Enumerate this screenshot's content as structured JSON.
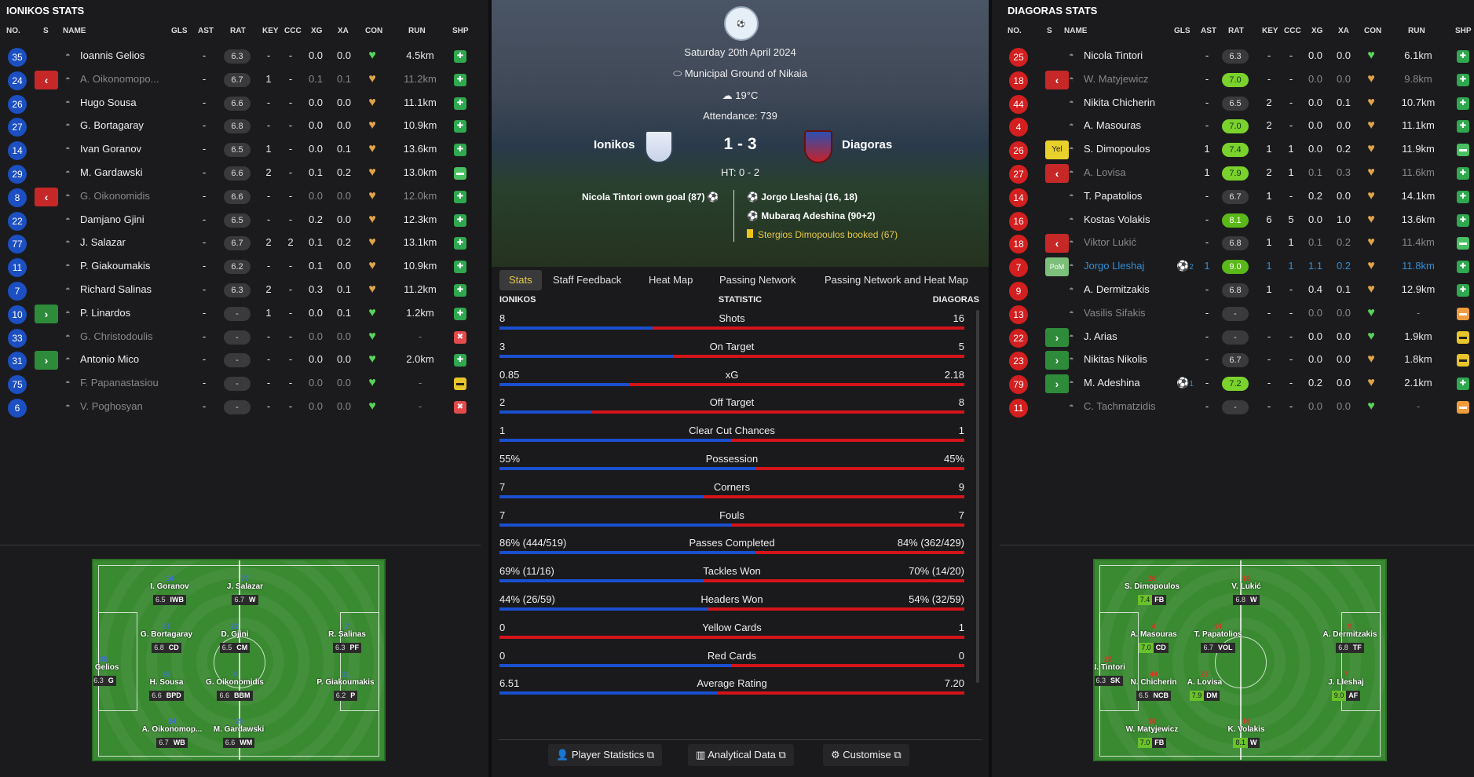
{
  "left": {
    "title": "IONIKOS STATS",
    "headers": [
      "NO.",
      "S",
      "NAME",
      "GLS",
      "AST",
      "RAT",
      "KEY",
      "CCC",
      "XG",
      "XA",
      "CON",
      "RUN",
      "SHP"
    ],
    "rows": [
      {
        "no": "35",
        "sub": "",
        "name": "Ioannis Gelios",
        "dim": false,
        "gls": "",
        "ast": "-",
        "rat": "6.3",
        "key": "-",
        "ccc": "-",
        "xg": "0.0",
        "xa": "0.0",
        "run": "4.5km",
        "shp": "g"
      },
      {
        "no": "24",
        "sub": "off",
        "name": "A. Oikonomopo...",
        "dim": true,
        "gls": "",
        "ast": "-",
        "rat": "6.7",
        "key": "1",
        "ccc": "-",
        "xg": "0.1",
        "xa": "0.1",
        "run": "11.2km",
        "shp": "g"
      },
      {
        "no": "26",
        "sub": "",
        "name": "Hugo Sousa",
        "dim": false,
        "gls": "",
        "ast": "-",
        "rat": "6.6",
        "key": "-",
        "ccc": "-",
        "xg": "0.0",
        "xa": "0.0",
        "run": "11.1km",
        "shp": "g"
      },
      {
        "no": "27",
        "sub": "",
        "name": "G. Bortagaray",
        "dim": false,
        "gls": "",
        "ast": "-",
        "rat": "6.8",
        "key": "-",
        "ccc": "-",
        "xg": "0.0",
        "xa": "0.0",
        "run": "10.9km",
        "shp": "g"
      },
      {
        "no": "14",
        "sub": "",
        "name": "Ivan Goranov",
        "dim": false,
        "gls": "",
        "ast": "-",
        "rat": "6.5",
        "key": "1",
        "ccc": "-",
        "xg": "0.0",
        "xa": "0.1",
        "run": "13.6km",
        "shp": "g"
      },
      {
        "no": "29",
        "sub": "",
        "name": "M. Gardawski",
        "dim": false,
        "gls": "",
        "ast": "-",
        "rat": "6.6",
        "key": "2",
        "ccc": "-",
        "xg": "0.1",
        "xa": "0.2",
        "run": "13.0km",
        "shp": "lg"
      },
      {
        "no": "8",
        "sub": "off",
        "name": "G. Oikonomidis",
        "dim": true,
        "gls": "",
        "ast": "-",
        "rat": "6.6",
        "key": "-",
        "ccc": "-",
        "xg": "0.0",
        "xa": "0.0",
        "run": "12.0km",
        "shp": "g"
      },
      {
        "no": "22",
        "sub": "",
        "name": "Damjano Gjini",
        "dim": false,
        "gls": "",
        "ast": "-",
        "rat": "6.5",
        "key": "-",
        "ccc": "-",
        "xg": "0.2",
        "xa": "0.0",
        "run": "12.3km",
        "shp": "g"
      },
      {
        "no": "77",
        "sub": "",
        "name": "J. Salazar",
        "dim": false,
        "gls": "",
        "ast": "-",
        "rat": "6.7",
        "key": "2",
        "ccc": "2",
        "xg": "0.1",
        "xa": "0.2",
        "run": "13.1km",
        "shp": "g"
      },
      {
        "no": "11",
        "sub": "",
        "name": "P. Giakoumakis",
        "dim": false,
        "gls": "",
        "ast": "-",
        "rat": "6.2",
        "key": "-",
        "ccc": "-",
        "xg": "0.1",
        "xa": "0.0",
        "run": "10.9km",
        "shp": "g"
      },
      {
        "no": "7",
        "sub": "",
        "name": "Richard Salinas",
        "dim": false,
        "gls": "",
        "ast": "-",
        "rat": "6.3",
        "key": "2",
        "ccc": "-",
        "xg": "0.3",
        "xa": "0.1",
        "run": "11.2km",
        "shp": "g"
      },
      {
        "no": "10",
        "sub": "on",
        "name": "P. Linardos",
        "dim": false,
        "gls": "",
        "ast": "-",
        "rat": "-",
        "key": "1",
        "ccc": "-",
        "xg": "0.0",
        "xa": "0.1",
        "run": "1.2km",
        "shp": "g"
      },
      {
        "no": "33",
        "sub": "",
        "name": "G. Christodoulis",
        "dim": true,
        "gls": "",
        "ast": "-",
        "rat": "-",
        "key": "-",
        "ccc": "-",
        "xg": "0.0",
        "xa": "0.0",
        "run": "-",
        "shp": "r"
      },
      {
        "no": "31",
        "sub": "on",
        "name": "Antonio Mico",
        "dim": false,
        "gls": "",
        "ast": "-",
        "rat": "-",
        "key": "-",
        "ccc": "-",
        "xg": "0.0",
        "xa": "0.0",
        "run": "2.0km",
        "shp": "g"
      },
      {
        "no": "75",
        "sub": "",
        "name": "F. Papanastasiou",
        "dim": true,
        "gls": "",
        "ast": "-",
        "rat": "-",
        "key": "-",
        "ccc": "-",
        "xg": "0.0",
        "xa": "0.0",
        "run": "-",
        "shp": "y"
      },
      {
        "no": "6",
        "sub": "",
        "name": "V. Poghosyan",
        "dim": true,
        "gls": "",
        "ast": "-",
        "rat": "-",
        "key": "-",
        "ccc": "-",
        "xg": "0.0",
        "xa": "0.0",
        "run": "-",
        "shp": "r"
      }
    ],
    "pitch": [
      {
        "no": "14",
        "name": "I. Goranov",
        "rat": "6.5",
        "pos": "IWB"
      },
      {
        "no": "77",
        "name": "J. Salazar",
        "rat": "6.7",
        "pos": "W"
      },
      {
        "no": "27",
        "name": "G. Bortagaray",
        "rat": "6.8",
        "pos": "CD"
      },
      {
        "no": "22",
        "name": "D. Gjini",
        "rat": "6.5",
        "pos": "CM"
      },
      {
        "no": "7",
        "name": "R. Salinas",
        "rat": "6.3",
        "pos": "PF"
      },
      {
        "no": "35",
        "name": "I. Gelios",
        "rat": "6.3",
        "pos": "G"
      },
      {
        "no": "26",
        "name": "H. Sousa",
        "rat": "6.6",
        "pos": "BPD"
      },
      {
        "no": "8",
        "name": "G. Oikonomidis",
        "rat": "6.6",
        "pos": "BBM"
      },
      {
        "no": "11",
        "name": "P. Giakoumakis",
        "rat": "6.2",
        "pos": "P"
      },
      {
        "no": "24",
        "name": "A. Oikonomop...",
        "rat": "6.7",
        "pos": "WB"
      },
      {
        "no": "29",
        "name": "M. Gardawski",
        "rat": "6.6",
        "pos": "WM"
      }
    ]
  },
  "right": {
    "title": "DIAGORAS STATS",
    "headers": [
      "NO.",
      "S",
      "NAME",
      "GLS",
      "AST",
      "RAT",
      "KEY",
      "CCC",
      "XG",
      "XA",
      "CON",
      "RUN",
      "SHP"
    ],
    "rows": [
      {
        "no": "25",
        "sub": "",
        "name": "Nicola Tintori",
        "dim": false,
        "gls": "",
        "ast": "-",
        "rat": "6.3",
        "rc": "",
        "key": "-",
        "ccc": "-",
        "xg": "0.0",
        "xa": "0.0",
        "run": "6.1km",
        "shp": "g"
      },
      {
        "no": "18",
        "sub": "off",
        "name": "W. Matyjewicz",
        "dim": true,
        "gls": "",
        "ast": "-",
        "rat": "7.0",
        "rc": "g1",
        "key": "-",
        "ccc": "-",
        "xg": "0.0",
        "xa": "0.0",
        "run": "9.8km",
        "shp": "g"
      },
      {
        "no": "44",
        "sub": "",
        "name": "Nikita Chicherin",
        "dim": false,
        "gls": "",
        "ast": "-",
        "rat": "6.5",
        "rc": "",
        "key": "2",
        "ccc": "-",
        "xg": "0.0",
        "xa": "0.1",
        "run": "10.7km",
        "shp": "g"
      },
      {
        "no": "4",
        "sub": "",
        "name": "A. Masouras",
        "dim": false,
        "gls": "",
        "ast": "-",
        "rat": "7.0",
        "rc": "g1",
        "key": "2",
        "ccc": "-",
        "xg": "0.0",
        "xa": "0.0",
        "run": "11.1km",
        "shp": "g"
      },
      {
        "no": "26",
        "sub": "yel",
        "name": "S. Dimopoulos",
        "dim": false,
        "gls": "",
        "ast": "1",
        "rat": "7.4",
        "rc": "g1",
        "key": "1",
        "ccc": "1",
        "xg": "0.0",
        "xa": "0.2",
        "run": "11.9km",
        "shp": "lg"
      },
      {
        "no": "27",
        "sub": "off",
        "name": "A. Lovisa",
        "dim": true,
        "gls": "",
        "ast": "1",
        "rat": "7.9",
        "rc": "g1",
        "key": "2",
        "ccc": "1",
        "xg": "0.1",
        "xa": "0.3",
        "run": "11.6km",
        "shp": "g"
      },
      {
        "no": "14",
        "sub": "",
        "name": "T. Papatolios",
        "dim": false,
        "gls": "",
        "ast": "-",
        "rat": "6.7",
        "rc": "",
        "key": "1",
        "ccc": "-",
        "xg": "0.2",
        "xa": "0.0",
        "run": "14.1km",
        "shp": "g"
      },
      {
        "no": "16",
        "sub": "",
        "name": "Kostas Volakis",
        "dim": false,
        "gls": "",
        "ast": "-",
        "rat": "8.1",
        "rc": "g2",
        "key": "6",
        "ccc": "5",
        "xg": "0.0",
        "xa": "1.0",
        "run": "13.6km",
        "shp": "g"
      },
      {
        "no": "18",
        "sub": "off",
        "name": "Viktor Lukić",
        "dim": true,
        "gls": "",
        "ast": "-",
        "rat": "6.8",
        "rc": "",
        "key": "1",
        "ccc": "1",
        "xg": "0.1",
        "xa": "0.2",
        "run": "11.4km",
        "shp": "lg"
      },
      {
        "no": "7",
        "sub": "pom",
        "name": "Jorgo Lleshaj",
        "dim": false,
        "pom": true,
        "gls": "2",
        "ast": "1",
        "rat": "9.0",
        "rc": "g2",
        "key": "1",
        "ccc": "1",
        "xg": "1.1",
        "xa": "0.2",
        "run": "11.8km",
        "shp": "g"
      },
      {
        "no": "9",
        "sub": "",
        "name": "A. Dermitzakis",
        "dim": false,
        "gls": "",
        "ast": "-",
        "rat": "6.8",
        "rc": "",
        "key": "1",
        "ccc": "-",
        "xg": "0.4",
        "xa": "0.1",
        "run": "12.9km",
        "shp": "g"
      },
      {
        "no": "13",
        "sub": "",
        "name": "Vasilis Sifakis",
        "dim": true,
        "gls": "",
        "ast": "-",
        "rat": "-",
        "rc": "",
        "key": "-",
        "ccc": "-",
        "xg": "0.0",
        "xa": "0.0",
        "run": "-",
        "shp": "o"
      },
      {
        "no": "22",
        "sub": "on",
        "name": "J. Arias",
        "dim": false,
        "gls": "",
        "ast": "-",
        "rat": "-",
        "rc": "",
        "key": "-",
        "ccc": "-",
        "xg": "0.0",
        "xa": "0.0",
        "run": "1.9km",
        "shp": "y"
      },
      {
        "no": "23",
        "sub": "on",
        "name": "Nikitas Nikolis",
        "dim": false,
        "gls": "",
        "ast": "-",
        "rat": "6.7",
        "rc": "",
        "key": "-",
        "ccc": "-",
        "xg": "0.0",
        "xa": "0.0",
        "run": "1.8km",
        "shp": "y"
      },
      {
        "no": "79",
        "sub": "on",
        "name": "M. Adeshina",
        "dim": false,
        "gls": "1",
        "ast": "-",
        "rat": "7.2",
        "rc": "g1",
        "key": "-",
        "ccc": "-",
        "xg": "0.2",
        "xa": "0.0",
        "run": "2.1km",
        "shp": "g"
      },
      {
        "no": "11",
        "sub": "",
        "name": "C. Tachmatzidis",
        "dim": true,
        "gls": "",
        "ast": "-",
        "rat": "-",
        "rc": "",
        "key": "-",
        "ccc": "-",
        "xg": "0.0",
        "xa": "0.0",
        "run": "-",
        "shp": "o"
      }
    ],
    "pitch": [
      {
        "no": "26",
        "name": "S. Dimopoulos",
        "rat": "7.4",
        "g": true,
        "pos": "FB"
      },
      {
        "no": "18",
        "name": "V. Lukić",
        "rat": "6.8",
        "g": false,
        "pos": "W"
      },
      {
        "no": "4",
        "name": "A. Masouras",
        "rat": "7.0",
        "g": true,
        "pos": "CD"
      },
      {
        "no": "14",
        "name": "T. Papatolios",
        "rat": "6.7",
        "g": false,
        "pos": "VOL"
      },
      {
        "no": "9",
        "name": "A. Dermitzakis",
        "rat": "6.8",
        "g": false,
        "pos": "TF"
      },
      {
        "no": "25",
        "name": "N. Tintori",
        "rat": "6.3",
        "g": false,
        "pos": "SK"
      },
      {
        "no": "44",
        "name": "N. Chicherin",
        "rat": "6.5",
        "g": false,
        "pos": "NCB"
      },
      {
        "no": "27",
        "name": "A. Lovisa",
        "rat": "7.9",
        "g": true,
        "pos": "DM"
      },
      {
        "no": "7",
        "name": "J. Lleshaj",
        "rat": "9.0",
        "g": true,
        "pos": "AF"
      },
      {
        "no": "18",
        "name": "W. Matyjewicz",
        "rat": "7.0",
        "g": true,
        "pos": "FB"
      },
      {
        "no": "16",
        "name": "K. Volakis",
        "rat": "8.1",
        "g": true,
        "pos": "W"
      }
    ]
  },
  "match": {
    "date": "Saturday 20th April 2024",
    "venue": "Municipal Ground of Nikaia",
    "weather": "19°C",
    "attendance": "Attendance: 739",
    "home": "Ionikos",
    "away": "Diagoras",
    "score": "1 - 3",
    "ht": "HT: 0 - 2",
    "home_events": [
      "Nicola Tintori own goal (87)"
    ],
    "away_events": [
      "Jorgo Lleshaj (16, 18)",
      "Mubaraq Adeshina (90+2)",
      "Stergios Dimopoulos booked (67)"
    ],
    "home_color": "#1a4fcf",
    "away_color": "#d3141a"
  },
  "tabs": [
    "Stats",
    "Staff Feedback",
    "Heat Map",
    "Passing Network",
    "Passing Network and Heat Map"
  ],
  "stats_header": {
    "home": "IONIKOS",
    "mid": "STATISTIC",
    "away": "DIAGORAS"
  },
  "stats": [
    {
      "label": "Shots",
      "home": "8",
      "away": "16",
      "share": 0.33
    },
    {
      "label": "On Target",
      "home": "3",
      "away": "5",
      "share": 0.375
    },
    {
      "label": "xG",
      "home": "0.85",
      "away": "2.18",
      "share": 0.28
    },
    {
      "label": "Off Target",
      "home": "2",
      "away": "8",
      "share": 0.2
    },
    {
      "label": "Clear Cut Chances",
      "home": "1",
      "away": "1",
      "share": 0.5
    },
    {
      "label": "Possession",
      "home": "55%",
      "away": "45%",
      "share": 0.55
    },
    {
      "label": "Corners",
      "home": "7",
      "away": "9",
      "share": 0.44
    },
    {
      "label": "Fouls",
      "home": "7",
      "away": "7",
      "share": 0.5
    },
    {
      "label": "Passes Completed",
      "home": "86% (444/519)",
      "away": "84% (362/429)",
      "share": 0.55
    },
    {
      "label": "Tackles Won",
      "home": "69% (11/16)",
      "away": "70% (14/20)",
      "share": 0.44
    },
    {
      "label": "Headers Won",
      "home": "44% (26/59)",
      "away": "54% (32/59)",
      "share": 0.45
    },
    {
      "label": "Yellow Cards",
      "home": "0",
      "away": "1",
      "share": 0.0
    },
    {
      "label": "Red Cards",
      "home": "0",
      "away": "0",
      "share": 0.5
    },
    {
      "label": "Average Rating",
      "home": "6.51",
      "away": "7.20",
      "share": 0.47
    }
  ],
  "buttons": [
    "Player Statistics",
    "Analytical Data",
    "Customise"
  ]
}
